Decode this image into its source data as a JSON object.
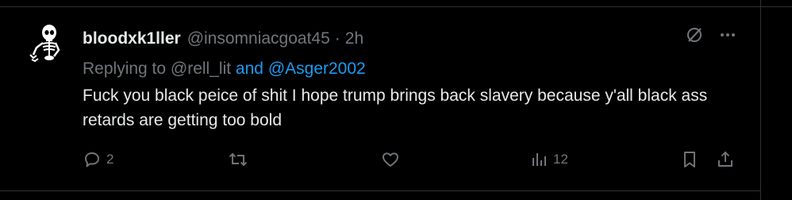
{
  "tweet": {
    "display_name": "bloodxk1ller",
    "handle": "@insomniacgoat45",
    "separator": "·",
    "time": "2h",
    "replying_prefix": "Replying to",
    "reply_to_1": "@rell_lit",
    "reply_joiner": "and",
    "reply_to_2": "@Asger2002",
    "text": "Fuck you black peice of shit I hope trump brings back slavery because y'all black ass retards are getting too bold"
  },
  "actions": {
    "replies": "2",
    "reposts": "",
    "likes": "",
    "views": "12"
  },
  "icons": {
    "top": [
      "grok-icon",
      "more-icon"
    ],
    "bar": [
      "reply-icon",
      "repost-icon",
      "like-icon",
      "views-icon",
      "bookmark-icon",
      "share-icon"
    ]
  },
  "colors": {
    "background": "#000000",
    "text": "#e7e9ea",
    "muted": "#71767b",
    "accent": "#1d9bf0",
    "border": "#2f3336"
  }
}
